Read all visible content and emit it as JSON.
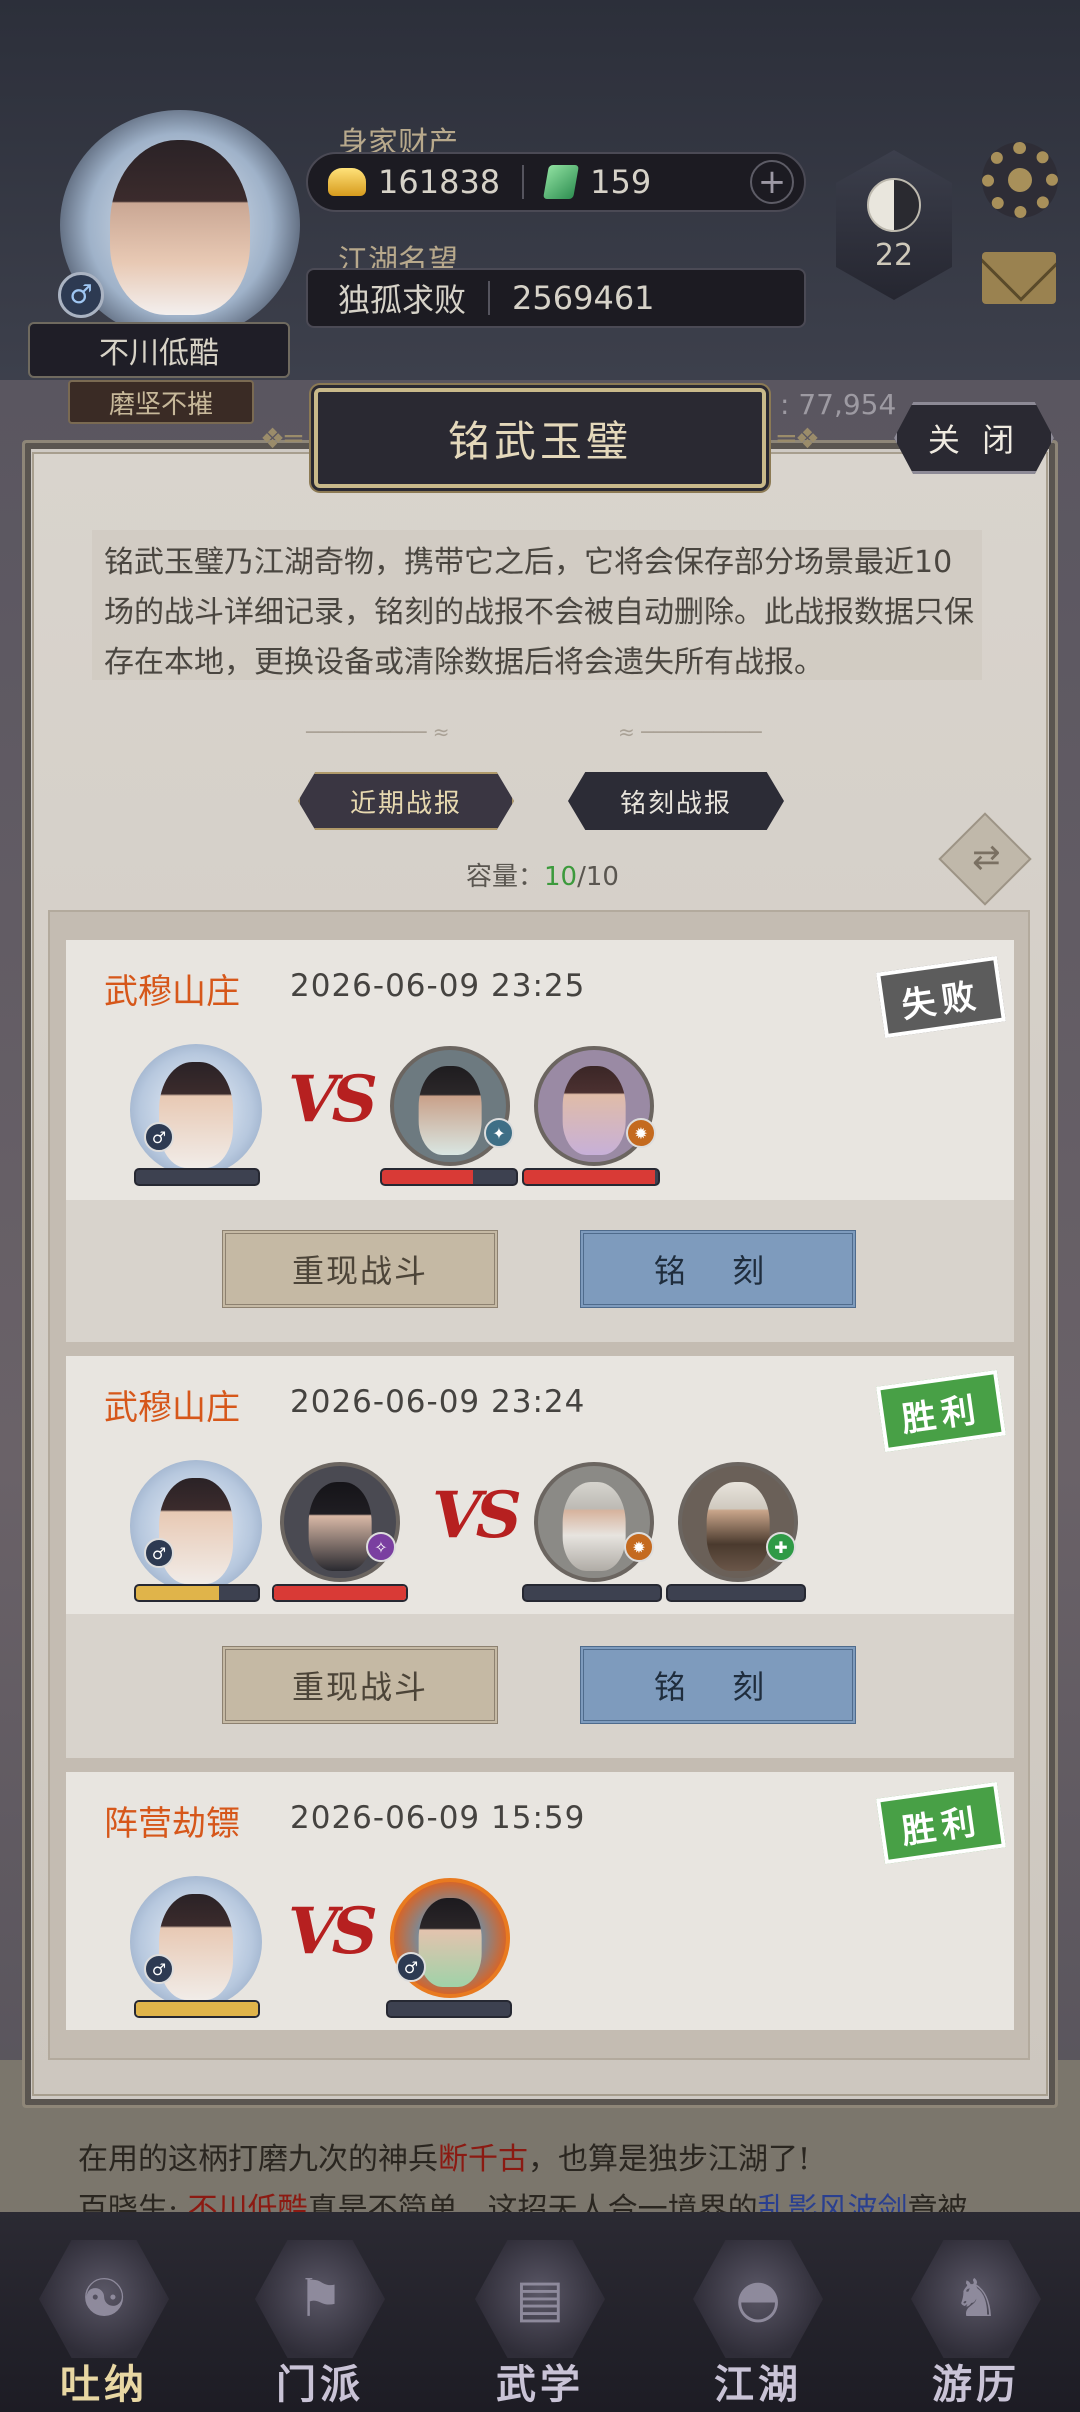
{
  "header": {
    "player_name": "不川低酷",
    "player_title": "磨坚不摧",
    "wealth_label": "身家财产",
    "gold": "161838",
    "jade": "159",
    "fame_label": "江湖名望",
    "fame_rank": "独孤求败",
    "fame_value": "2569461",
    "level": "22",
    "power_partial": ": 77,954"
  },
  "modal": {
    "title": "铭武玉璧",
    "close_label": "关 闭",
    "description": "铭武玉璧乃江湖奇物，携带它之后，它将会保存部分场景最近10场的战斗详细记录，铭刻的战报不会被自动删除。此战报数据只保存在本地，更换设备或清除数据后将会遗失所有战报。",
    "tabs": [
      {
        "label": "近期战报",
        "selected": true
      },
      {
        "label": "铭刻战报",
        "selected": false
      }
    ],
    "capacity_label": "容量：",
    "capacity_used": "10",
    "capacity_total": "/10"
  },
  "reports": [
    {
      "mode": "武穆山庄",
      "time": "2026-06-09 23:25",
      "result": "失败",
      "allies_hp": [
        0
      ],
      "enemies_hp": [
        0.68,
        0.98
      ],
      "replay_label": "重现战斗",
      "engrave_label": "铭 刻"
    },
    {
      "mode": "武穆山庄",
      "time": "2026-06-09 23:24",
      "result": "胜利",
      "allies_hp": [
        0.68,
        1.0
      ],
      "enemies_hp": [
        0,
        0
      ],
      "replay_label": "重现战斗",
      "engrave_label": "铭 刻"
    },
    {
      "mode": "阵营劫镖",
      "time": "2026-06-09 15:59",
      "result": "胜利",
      "allies_hp": [
        1.0
      ],
      "enemies_hp": [
        0
      ],
      "replay_label": "重现战斗",
      "engrave_label": "铭 刻"
    }
  ],
  "story": {
    "line1_pre": "在用的这柄打磨九次的神兵",
    "line1_hl": "断千古",
    "line1_post": "，也算是独步江湖了!",
    "line2_pre": "百晓生: ",
    "line2_hl": "不川低酷",
    "line2_mid": "真是不简单，这招天人合一境界的",
    "line2_hl2": "乱影风波剑",
    "line2_post": "竟被"
  },
  "nav": [
    {
      "label": "吐纳",
      "active": true
    },
    {
      "label": "门派",
      "active": false
    },
    {
      "label": "武学",
      "active": false
    },
    {
      "label": "江湖",
      "active": false
    },
    {
      "label": "游历",
      "active": false
    }
  ],
  "colors": {
    "hp_red": "#d93a36",
    "hp_gold": "#e0b44a",
    "win_green": "#48a046",
    "lose_gray": "#5c5c5c",
    "mode_orange": "#d6571a"
  }
}
